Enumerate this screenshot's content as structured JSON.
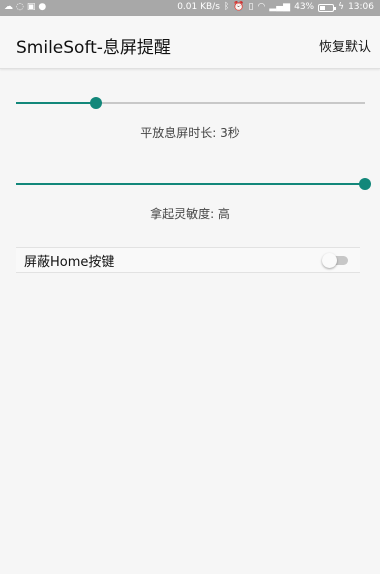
{
  "status_bar": {
    "net_speed": "0.01 KB/s",
    "battery_percent": "43%",
    "battery_level": 0.43,
    "time": "13:06",
    "left_icons": [
      "cloud-icon",
      "weather-icon",
      "image-icon",
      "dot-icon"
    ],
    "right_icons": [
      "bluetooth-icon",
      "alarm-icon",
      "vibrate-icon",
      "wifi-icon",
      "signal-icon",
      "battery-icon",
      "charging-icon"
    ]
  },
  "appbar": {
    "title": "SmileSoft-息屏提醒",
    "reset_label": "恢复默认"
  },
  "settings": {
    "screen_off_duration": {
      "label": "平放息屏时长: 3秒",
      "value_fraction": 0.23
    },
    "pickup_sensitivity": {
      "label": "拿起灵敏度: 高",
      "value_fraction": 1.0
    },
    "block_home_key": {
      "label": "屏蔽Home按键",
      "enabled": false
    }
  },
  "colors": {
    "accent": "#12877a",
    "status_bar": "#a8a8a8",
    "background": "#f6f6f6"
  }
}
